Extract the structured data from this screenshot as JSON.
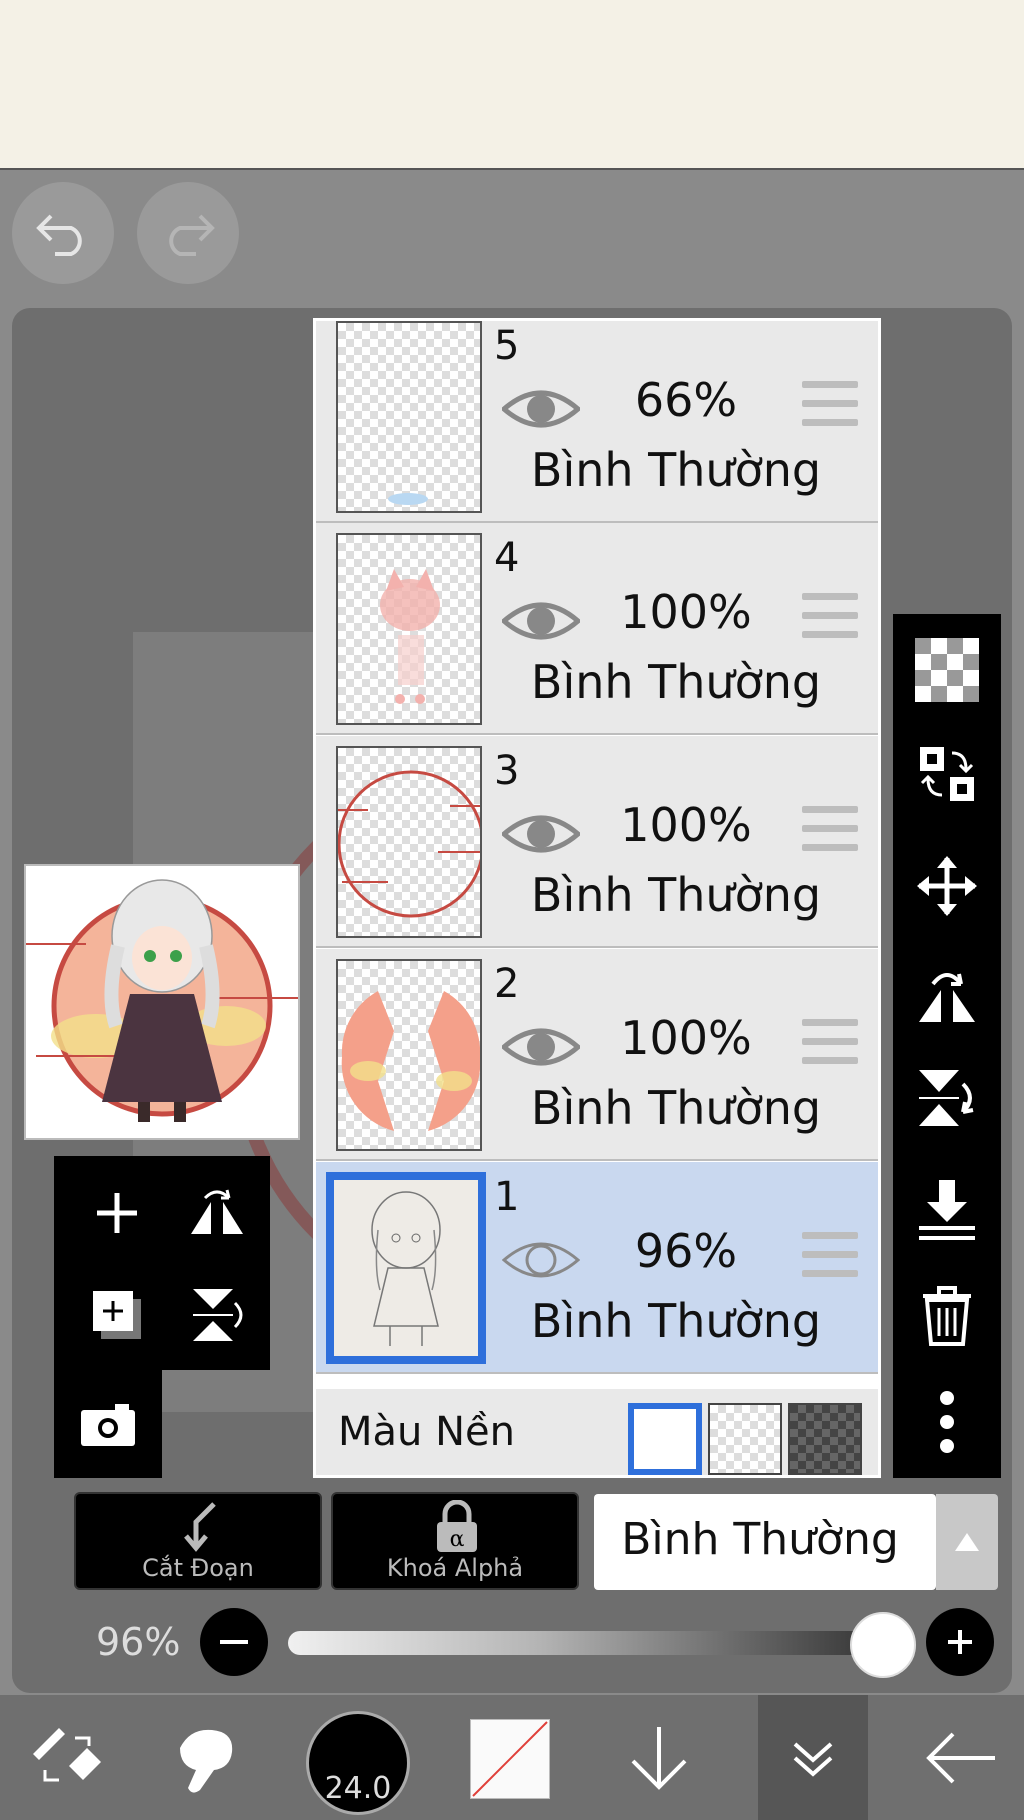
{
  "history": {
    "undo_icon": "undo-icon",
    "redo_icon": "redo-icon"
  },
  "layers": [
    {
      "number": "5",
      "opacity": "66%",
      "blend": "Bình Thường",
      "selected": false
    },
    {
      "number": "4",
      "opacity": "100%",
      "blend": "Bình Thường",
      "selected": false
    },
    {
      "number": "3",
      "opacity": "100%",
      "blend": "Bình Thường",
      "selected": false
    },
    {
      "number": "2",
      "opacity": "100%",
      "blend": "Bình Thường",
      "selected": false
    },
    {
      "number": "1",
      "opacity": "96%",
      "blend": "Bình Thường",
      "selected": true
    }
  ],
  "background": {
    "label": "Màu Nền",
    "selected_swatch": "white"
  },
  "bottom_controls": {
    "clip_label": "Cắt Đoạn",
    "alpha_label": "Khoá Alphả",
    "blend_mode": "Bình Thường",
    "opacity_label": "96%",
    "opacity_value": 0.96
  },
  "toolbar": {
    "brush_size": "24.0"
  },
  "colors": {
    "accent": "#2e6fdb",
    "selected_row": "#c9d8ef",
    "row": "#e9e9e9",
    "circle_red": "#c64a42"
  }
}
